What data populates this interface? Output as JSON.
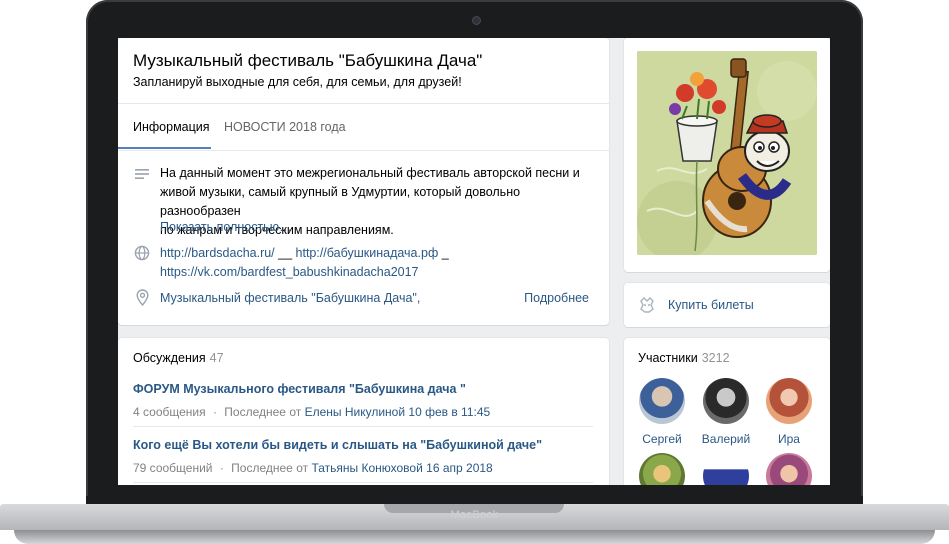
{
  "device": {
    "brand_label": "MacBook"
  },
  "group": {
    "title": "Музыкальный фестиваль \"Бабушкина Дача\"",
    "status": "Запланируй выходные для себя, для семьи, для друзей!"
  },
  "tabs": [
    {
      "label": "Информация",
      "active": true
    },
    {
      "label": "НОВОСТИ 2018 года",
      "active": false
    }
  ],
  "info": {
    "description_lines": [
      "На данный момент это межрегиональный фестиваль авторской песни и",
      "живой музыки, самый крупный в Удмуртии, который довольно разнообразен",
      "по жанрам и творческим направлениям."
    ],
    "show_more": "Показать полностью…",
    "links_line1_a": "http://bardsdacha.ru/",
    "links_sep1": " __ ",
    "links_line1_b": "http://бабушкинадача.рф",
    "links_sep2": " _",
    "links_line2": "https://vk.com/bardfest_babushkinadacha2017",
    "location": "Музыкальный фестиваль \"Бабушкина Дача\",",
    "details": "Подробнее"
  },
  "discussions": {
    "title": "Обсуждения",
    "count": "47",
    "topics": [
      {
        "title": "ФОРУМ Музыкального фестиваля \"Бабушкина дача \"",
        "posts": "4 сообщения",
        "dot": "·",
        "last_prefix": "Последнее от",
        "last_author": "Елены Никулиной",
        "last_date": "10 фев в 11:45"
      },
      {
        "title": "Кого ещё Вы хотели бы видеть и слышать на \"Бабушкиной даче\"",
        "posts": "79 сообщений",
        "dot": "·",
        "last_prefix": "Последнее от",
        "last_author": "Татьяны Конюховой",
        "last_date": "16 апр 2018"
      }
    ]
  },
  "buy": {
    "label": "Купить билеты"
  },
  "members": {
    "title": "Участники",
    "count": "3212",
    "people": [
      {
        "name": "Сергей"
      },
      {
        "name": "Валерий"
      },
      {
        "name": "Ира"
      },
      {
        "name": ""
      },
      {
        "name": ""
      },
      {
        "name": ""
      }
    ]
  },
  "colors": {
    "link": "#2a5885",
    "accent": "#5181b8",
    "page_bg": "#edeef0"
  }
}
